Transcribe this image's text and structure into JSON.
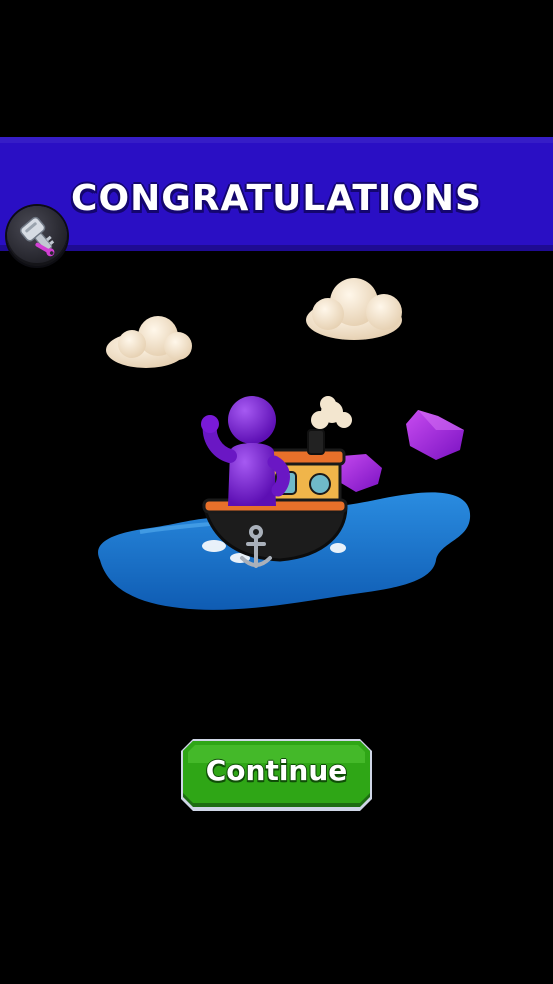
{
  "banner": {
    "title": "CONGRATULATIONS"
  },
  "tool_button": {
    "icon": "key-wrench-icon"
  },
  "scene": {
    "description_icons": [
      "cloud-icon",
      "boat-icon",
      "character-icon",
      "gem-icon",
      "water-icon",
      "anchor-icon"
    ]
  },
  "continue_button": {
    "label": "Continue"
  },
  "colors": {
    "banner": "#2a0fc4",
    "button_green": "#2fa616",
    "background": "#000000",
    "character_purple": "#7a1ad8",
    "water_blue": "#1f7fd4"
  }
}
